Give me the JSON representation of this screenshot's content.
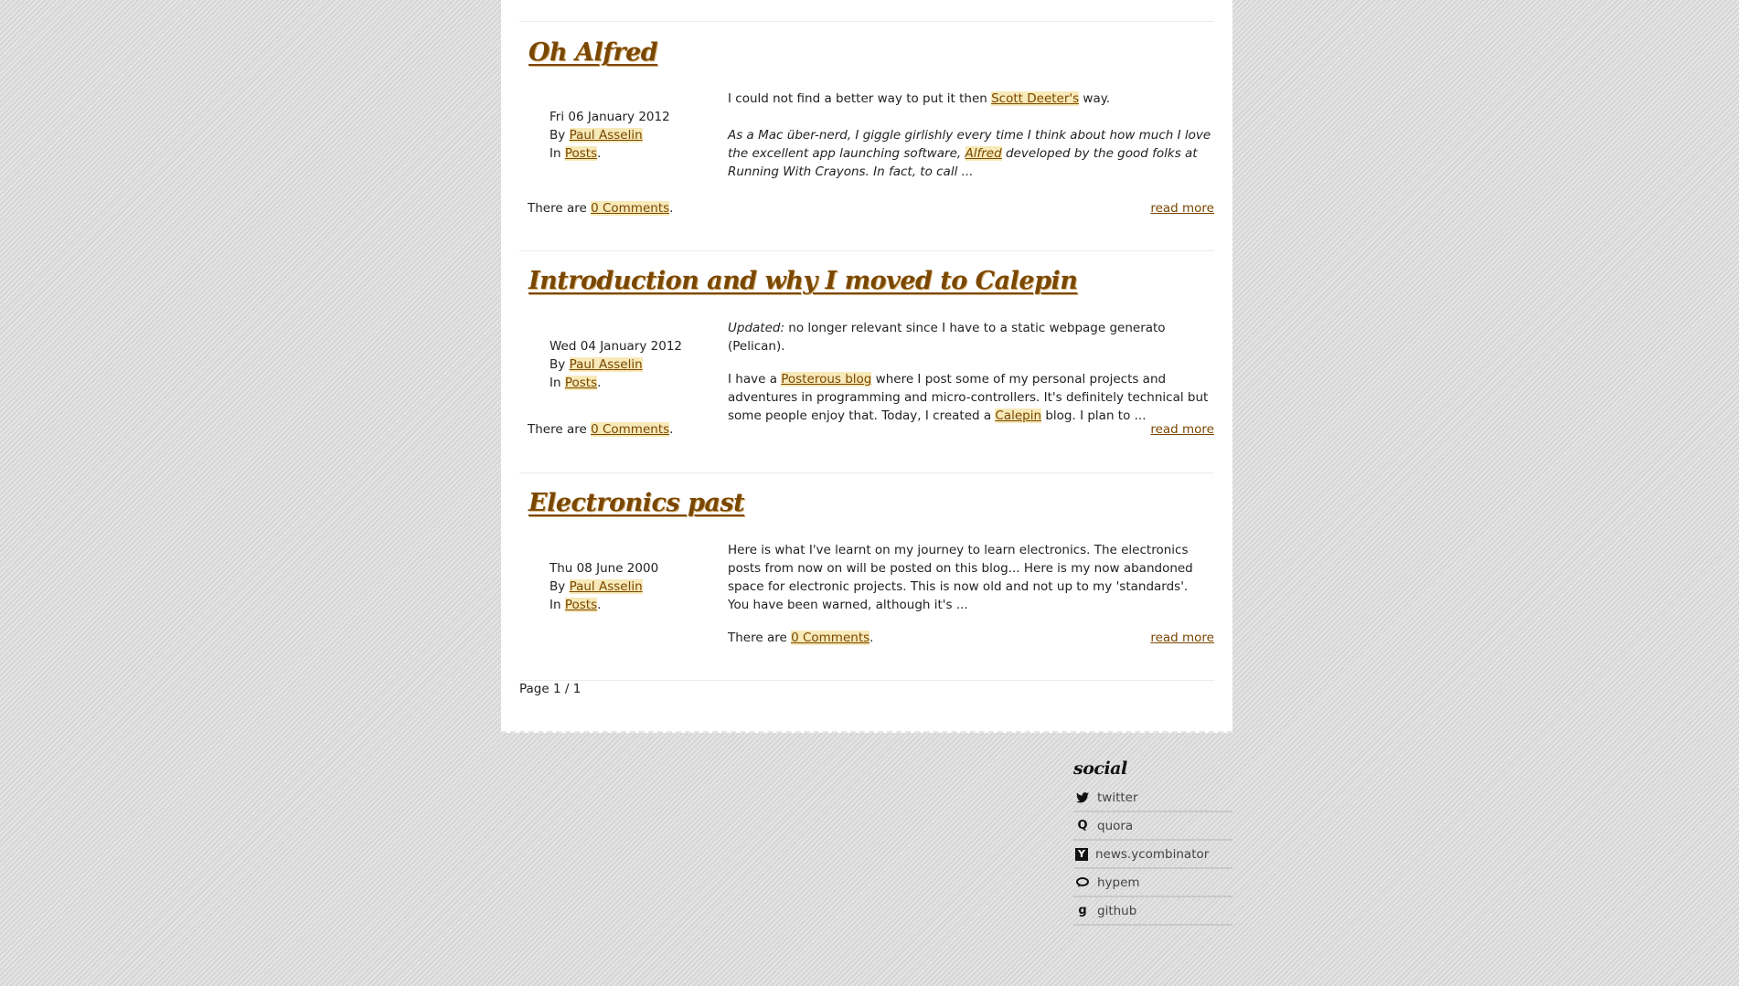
{
  "articles": [
    {
      "title": "Oh Alfred",
      "date": "Fri 06 January 2012",
      "by_prefix": "By",
      "author": "Paul Asselin",
      "in_prefix": "In",
      "category": "Posts",
      "p1_pre": "I could not find a better way to put it then ",
      "p1_link": "Scott Deeter's",
      "p1_post": " way.",
      "p2_pre": "As a Mac über-nerd, I giggle girlishly every time I think about how much I love the excellent app launching software, ",
      "p2_link": "Alfred",
      "p2_post": " developed by the good folks at Running With Crayons. In fact, to call ...",
      "comments_prefix": "There are ",
      "comments_link": "0 Comments",
      "comments_suffix": ".",
      "read_more": "read more"
    },
    {
      "title": "Introduction and why I moved to Calepin",
      "date": "Wed 04 January 2012",
      "by_prefix": "By",
      "author": "Paul Asselin",
      "in_prefix": "In",
      "category": "Posts",
      "p1_em": "Updated:",
      "p1_rest": " no longer relevant since I have to a static webpage generato (Pelican).",
      "p2_pre": "I have a ",
      "p2_link1": "Posterous blog",
      "p2_mid": " where I post some of my personal projects and adventures in programming and micro-controllers. It's definitely technical but some people enjoy that. Today, I created a ",
      "p2_link2": "Calepin",
      "p2_post": " blog. I plan to ...",
      "comments_prefix": "There are ",
      "comments_link": "0 Comments",
      "comments_suffix": ".",
      "read_more": "read more"
    },
    {
      "title": "Electronics past",
      "date": "Thu 08 June 2000",
      "by_prefix": "By",
      "author": "Paul Asselin",
      "in_prefix": "In",
      "category": "Posts",
      "p1": "Here is what I've learnt on my journey to learn electronics. The electronics posts from now on will be posted on this blog... Here is my now abandoned space for electronic projects. This is now old and not up to my 'standards'. You have been warned, although it's ...",
      "comments_prefix": "There are ",
      "comments_link": "0 Comments",
      "comments_suffix": ".",
      "read_more": "read more"
    }
  ],
  "pager": "Page 1 / 1",
  "social": {
    "heading": "social",
    "items": [
      {
        "label": "twitter",
        "icon": "twitter-icon"
      },
      {
        "label": "quora",
        "icon": "quora-icon"
      },
      {
        "label": "news.ycombinator",
        "icon": "ycombinator-icon"
      },
      {
        "label": "hypem",
        "icon": "hypem-icon"
      },
      {
        "label": "github",
        "icon": "github-icon"
      }
    ]
  }
}
